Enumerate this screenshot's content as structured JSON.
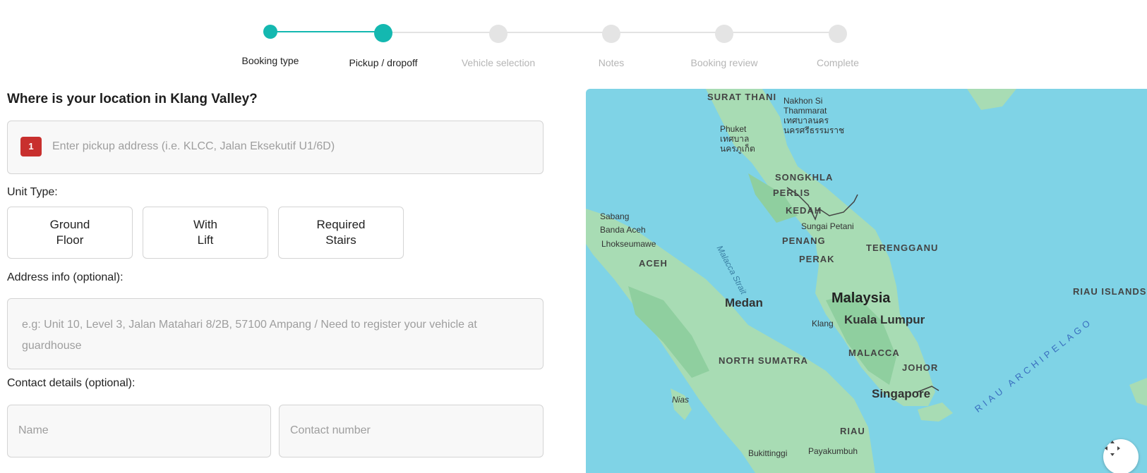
{
  "stepper": {
    "steps": [
      {
        "label": "Booking type",
        "state": "done"
      },
      {
        "label": "Pickup / dropoff",
        "state": "active"
      },
      {
        "label": "Vehicle selection",
        "state": "pending"
      },
      {
        "label": "Notes",
        "state": "pending"
      },
      {
        "label": "Booking review",
        "state": "pending"
      },
      {
        "label": "Complete",
        "state": "pending"
      }
    ]
  },
  "form": {
    "title": "Where is your location in Klang Valley?",
    "pickup": {
      "badge": "1",
      "placeholder": "Enter pickup address (i.e. KLCC, Jalan Eksekutif U1/6D)"
    },
    "unit_type": {
      "label": "Unit Type:",
      "options": [
        "Ground\nFloor",
        "With\nLift",
        "Required\nStairs"
      ]
    },
    "address_info": {
      "label": "Address info (optional):",
      "placeholder": "e.g: Unit 10, Level 3, Jalan Matahari 8/2B, 57100 Ampang / Need to register your vehicle at guardhouse"
    },
    "contact": {
      "label": "Contact details (optional):",
      "name_placeholder": "Name",
      "number_placeholder": "Contact number"
    }
  },
  "map": {
    "labels": {
      "surat_thani": "SURAT THANI",
      "nakhon": "Nakhon Si\nThammarat\nเทศบาลนคร\nนครศรีธรรมราช",
      "phuket": "Phuket\nเทศบาล\nนครภูเก็ต",
      "songkhla": "SONGKHLA",
      "perlis": "PERLIS",
      "kedah": "KEDAH",
      "sabang": "Sabang",
      "banda_aceh": "Banda Aceh",
      "sungai_petani": "Sungai Petani",
      "lhokseumawe": "Lhokseumawe",
      "penang": "PENANG",
      "malacca_strait": "Malacca Strait",
      "terengganu": "TERENGGANU",
      "perak": "PERAK",
      "aceh": "ACEH",
      "riau_islands": "RIAU ISLANDS",
      "medan": "Medan",
      "malaysia": "Malaysia",
      "klang": "Klang",
      "kuala_lumpur": "Kuala Lumpur",
      "riau_archipelago": "RIAU ARCHIPELAGO",
      "malacca": "MALACCA",
      "north_sumatra": "NORTH SUMATRA",
      "johor": "JOHOR",
      "singapore": "Singapore",
      "nias": "Nias",
      "riau": "RIAU",
      "bukittinggi": "Bukittinggi",
      "payakumbuh": "Payakumbuh"
    },
    "colors": {
      "water": "#7fd3e6",
      "land": "#a8dcb4",
      "land_dark": "#8fcf9f"
    }
  },
  "colors": {
    "accent": "#14b8b0",
    "badge": "#c8302e"
  }
}
